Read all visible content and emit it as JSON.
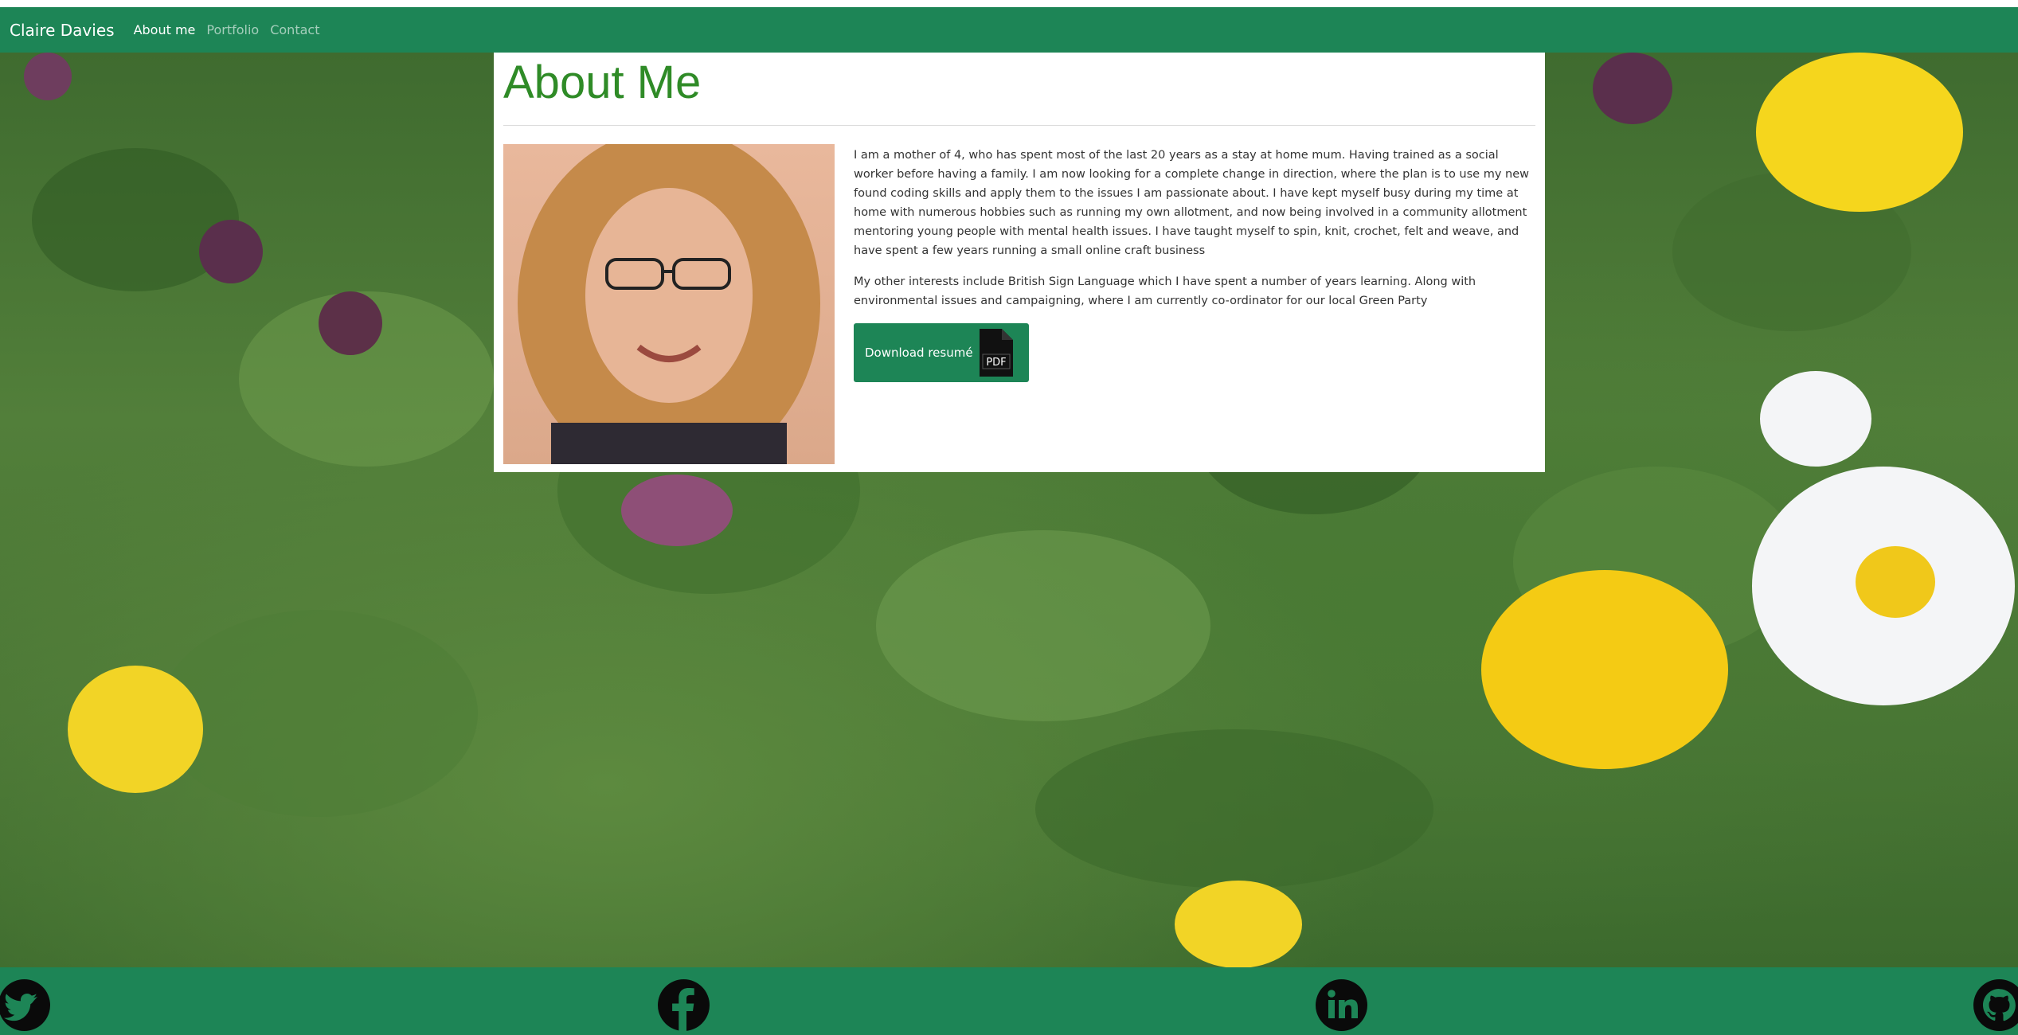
{
  "navbar": {
    "brand": "Claire Davies",
    "links": [
      {
        "label": "About me",
        "active": true
      },
      {
        "label": "Portfolio",
        "active": false
      },
      {
        "label": "Contact",
        "active": false
      }
    ]
  },
  "about": {
    "title": "About Me",
    "paragraphs": [
      "I am a mother of 4, who has spent most of the last 20 years as a stay at home mum. Having trained as a social worker before having a family. I am now looking for a complete change in direction, where the plan is to use my new found coding skills and apply them to the issues I am passionate about. I have kept myself busy during my time at home with numerous hobbies such as running my own allotment, and now being involved in a community allotment mentoring young people with mental health issues. I have taught myself to spin, knit, crochet, felt and weave, and have spent a few years running a small online craft business",
      "My other interests include British Sign Language which I have spent a number of years learning. Along with environmental issues and campaigning, where I am currently co-ordinator for our local Green Party"
    ],
    "download_label": "Download resumé",
    "pdf_icon_text": "PDF"
  },
  "footer": {
    "icons": [
      "twitter-icon",
      "facebook-icon",
      "linkedin-icon",
      "github-icon"
    ]
  },
  "colors": {
    "brand_green": "#1d8556",
    "title_green": "#2f8b27"
  }
}
